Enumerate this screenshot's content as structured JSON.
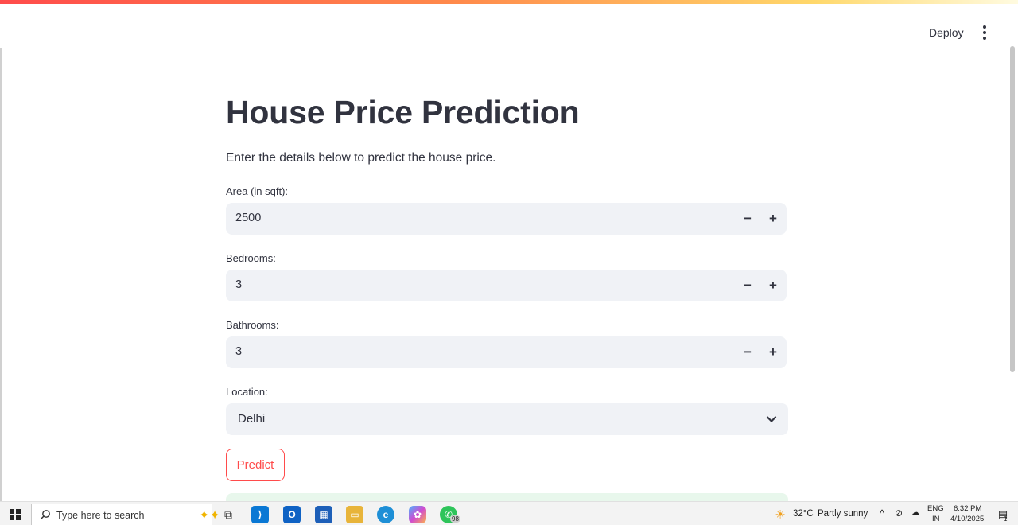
{
  "header": {
    "deploy_label": "Deploy"
  },
  "main": {
    "title": "House Price Prediction",
    "subtitle": "Enter the details below to predict the house price.",
    "fields": [
      {
        "label": "Area (in sqft):",
        "value": "2500"
      },
      {
        "label": "Bedrooms:",
        "value": "3"
      },
      {
        "label": "Bathrooms:",
        "value": "3"
      }
    ],
    "location": {
      "label": "Location:",
      "value": "Delhi"
    },
    "step_minus": "−",
    "step_plus": "+",
    "predict_label": "Predict"
  },
  "taskbar": {
    "search_placeholder": "Type here to search",
    "whatsapp_badge": "98",
    "weather_temp": "32°C",
    "weather_text": "Partly sunny",
    "lang_top": "ENG",
    "lang_bottom": "IN",
    "time": "6:32 PM",
    "date": "4/10/2025",
    "notification_count": "1"
  },
  "colors": {
    "accent": "#ff4b4b",
    "input_bg": "#f0f2f6",
    "text": "#31333f",
    "success_bg": "#e8f7ec"
  }
}
